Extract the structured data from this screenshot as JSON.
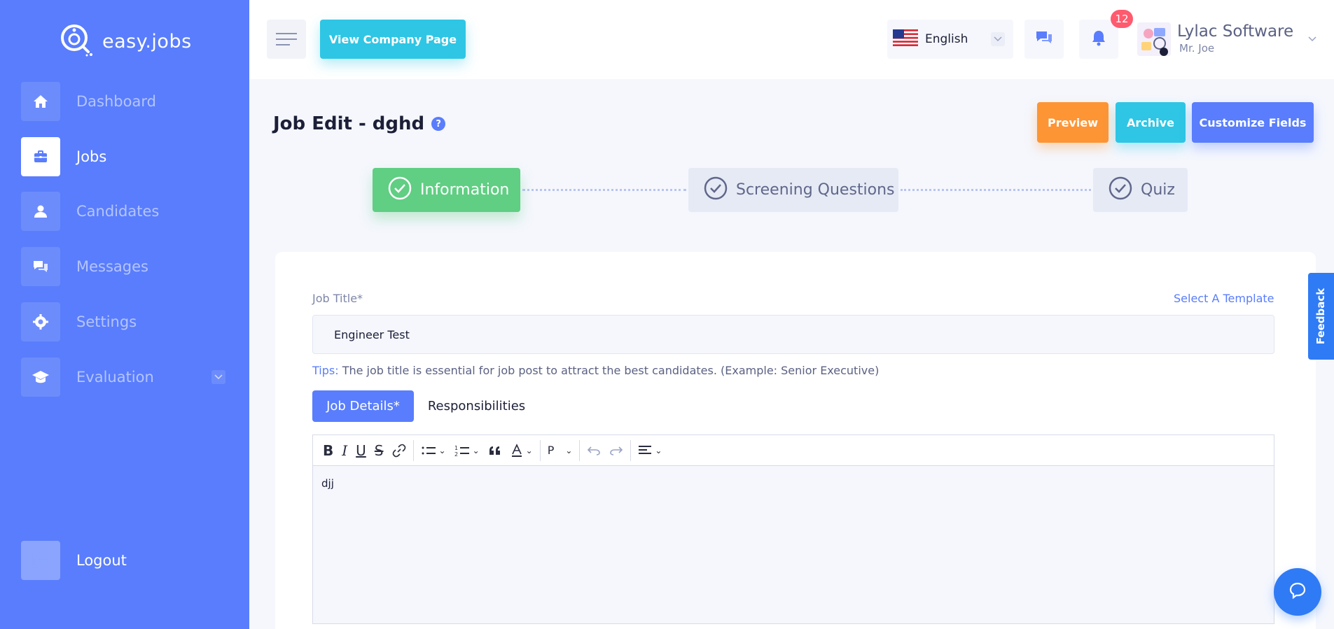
{
  "app": {
    "logo_text": "easy.jobs"
  },
  "sidebar": {
    "items": [
      {
        "label": "Dashboard",
        "icon": "home-icon"
      },
      {
        "label": "Jobs",
        "icon": "briefcase-icon",
        "active": true
      },
      {
        "label": "Candidates",
        "icon": "user-icon"
      },
      {
        "label": "Messages",
        "icon": "chat-icon"
      },
      {
        "label": "Settings",
        "icon": "gear-icon"
      },
      {
        "label": "Evaluation",
        "icon": "graduation-cap-icon",
        "has_submenu": true
      }
    ],
    "logout_label": "Logout"
  },
  "header": {
    "company_page_label": "View Company Page",
    "language": "English",
    "notifications_count": "12",
    "company_name": "Lylac Software",
    "user_name": "Mr. Joe"
  },
  "page": {
    "title": "Job Edit - dghd",
    "help_icon": "?",
    "actions": {
      "preview": "Preview",
      "archive": "Archive",
      "customize": "Customize Fields"
    },
    "steps": [
      {
        "label": "Information",
        "status": "active"
      },
      {
        "label": "Screening Questions",
        "status": "pending"
      },
      {
        "label": "Quiz",
        "status": "pending"
      }
    ]
  },
  "form": {
    "job_title_label": "Job Title*",
    "select_template": "Select A Template",
    "job_title_value": "Engineer Test",
    "tips_prefix": "Tips:",
    "tips_text": " The job title is essential for job post to attract the best candidates. (Example: Senior Executive)",
    "tabs": {
      "details": "Job Details*",
      "responsibilities": "Responsibilities"
    },
    "editor_content": "djj",
    "paragraph_format": "P"
  },
  "widgets": {
    "feedback": "Feedback"
  },
  "colors": {
    "sidebar": "#597dfc",
    "primary": "#597dfc",
    "cyan": "#2ec6e4",
    "orange": "#fd9535",
    "success": "#60ce83",
    "badge": "#ff5a6e",
    "feedback": "#2f7bf5"
  }
}
